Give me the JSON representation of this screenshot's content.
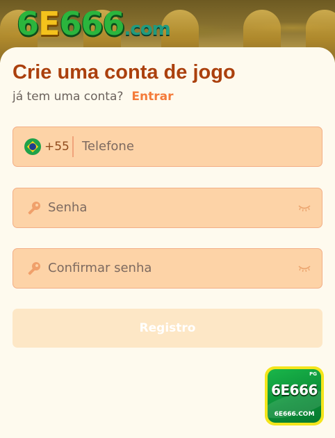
{
  "brand": {
    "logo_main": "6E666",
    "logo_suffix": ".com",
    "badge_mark": "6E666",
    "badge_url": "6E666.COM",
    "badge_tag": "PG"
  },
  "register_form": {
    "title": "Crie uma conta de jogo",
    "subtitle": "já tem uma conta?",
    "login_link": "Entrar",
    "phone": {
      "country_code": "+55",
      "placeholder": "Telefone"
    },
    "password": {
      "placeholder": "Senha"
    },
    "confirm_password": {
      "placeholder": "Confirmar senha"
    },
    "submit_label": "Registro"
  },
  "colors": {
    "title": "#ab400d",
    "link": "#f47b3a",
    "field_bg": "#fdd3a7",
    "field_border": "#f2ae86",
    "button_disabled_bg": "#fde7c6",
    "page_bg": "#fefaee"
  },
  "icons": {
    "flag": "brazil-flag-icon",
    "password": "key-icon",
    "visibility": "eye-closed-icon"
  }
}
